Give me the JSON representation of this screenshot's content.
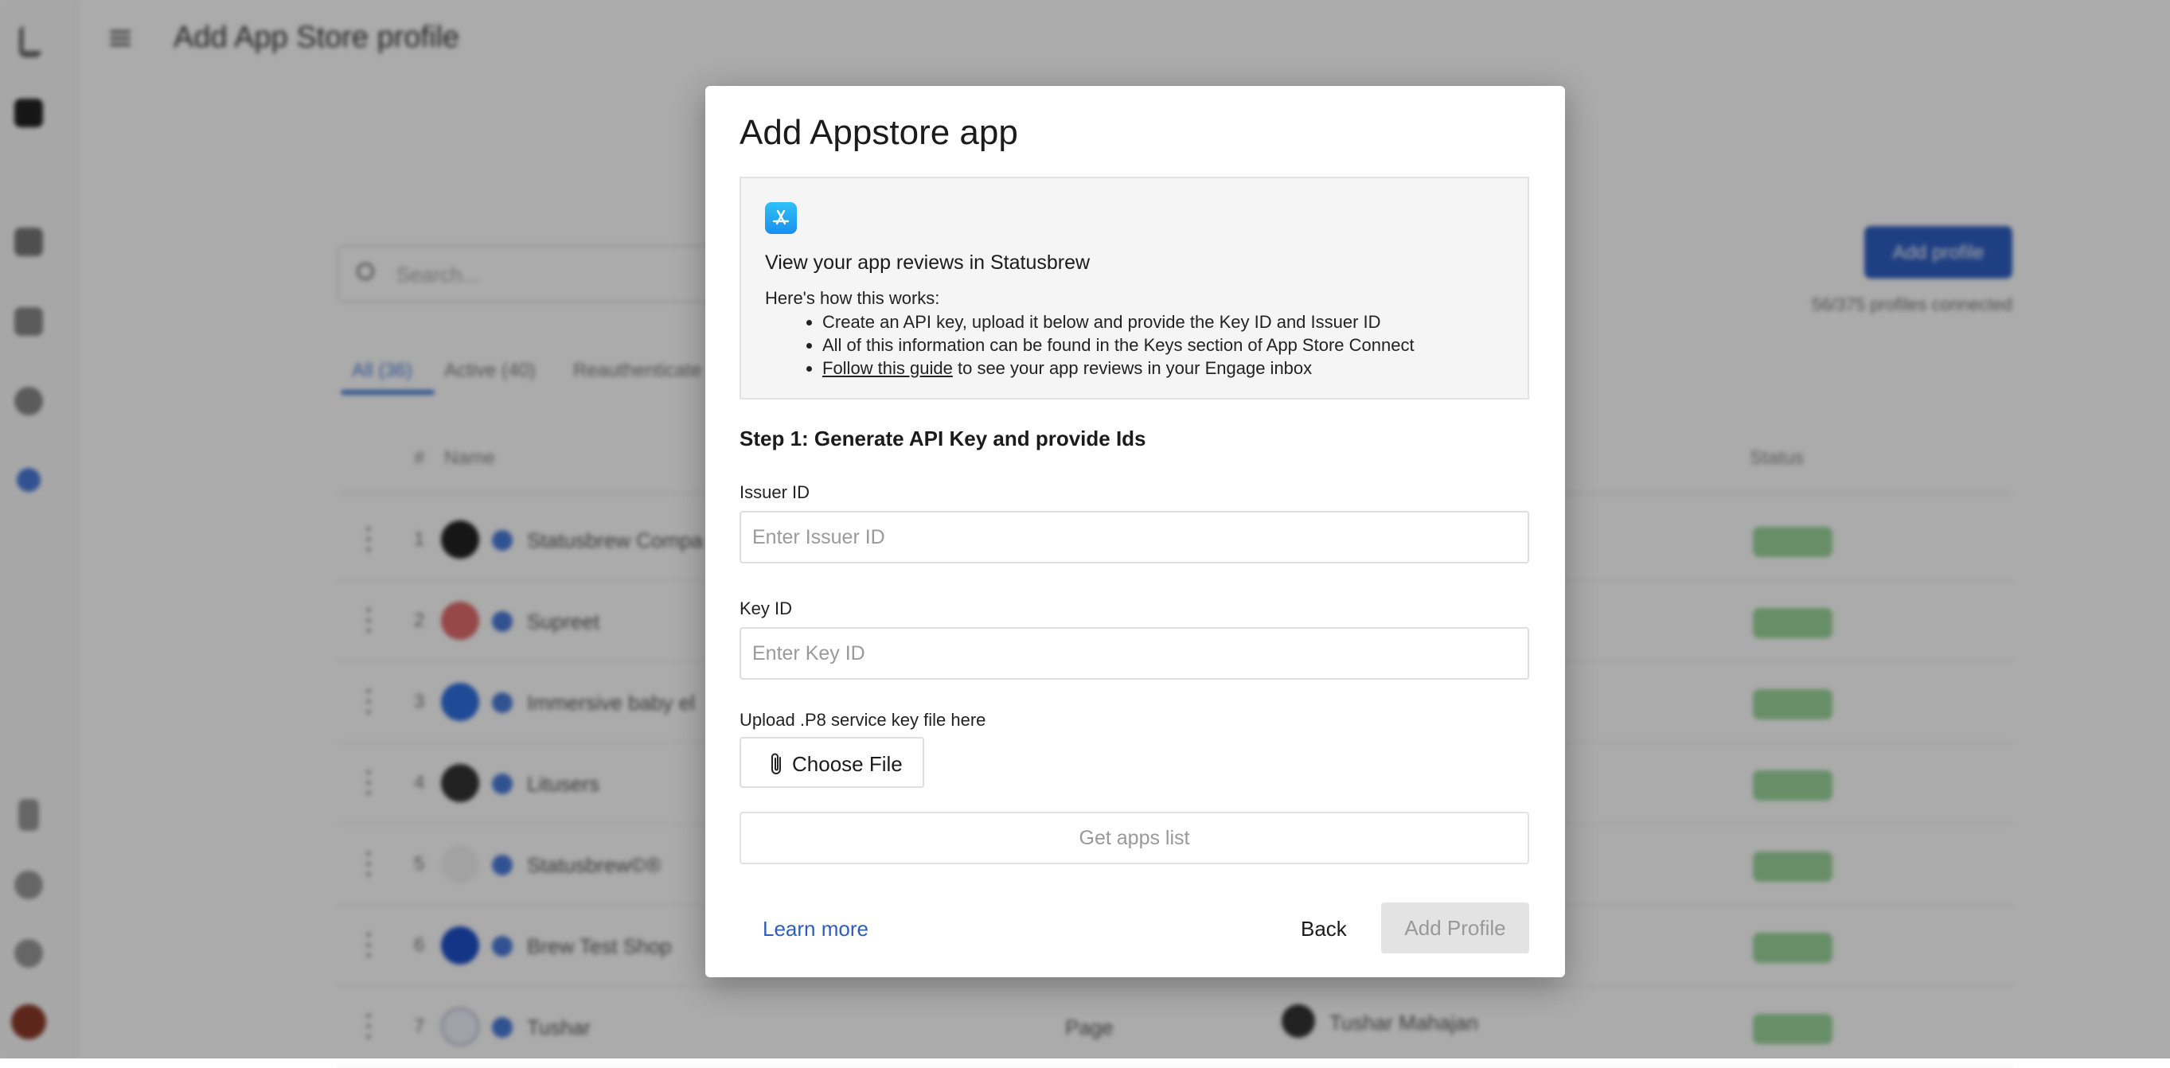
{
  "background": {
    "header_title": "Add App Store profile",
    "search_placeholder": "Search...",
    "tabs": [
      "All (36)",
      "Active (40)",
      "Reauthenticate"
    ],
    "columns": {
      "index": "#",
      "name": "Name",
      "status": "Status"
    },
    "rows": [
      {
        "n": "1",
        "name": "Statusbrew Compa"
      },
      {
        "n": "2",
        "name": "Supreet"
      },
      {
        "n": "3",
        "name": "Immersive baby el"
      },
      {
        "n": "4",
        "name": "Litusers"
      },
      {
        "n": "5",
        "name": "Statusbrew©®"
      },
      {
        "n": "6",
        "name": "Brew Test Shop"
      },
      {
        "n": "7",
        "name": "Tushar"
      }
    ],
    "row7_type": "Page",
    "row7_owner": "Tushar Mahajan",
    "add_profile_btn": "Add profile",
    "profiles_connected": "56/375 profiles connected"
  },
  "modal": {
    "title": "Add Appstore app",
    "info": {
      "icon": "app-store-icon",
      "heading": "View your app reviews in Statusbrew",
      "intro": "Here's how this works:",
      "bullets": [
        "Create an API key, upload it below and provide the Key ID and Issuer ID",
        "All of this information can be found in the Keys section of App Store Connect"
      ],
      "guide_link": "Follow this guide",
      "guide_suffix": " to see your app reviews in your Engage inbox"
    },
    "step_title": "Step 1: Generate API Key and provide Ids",
    "issuer": {
      "label": "Issuer ID",
      "placeholder": "Enter Issuer ID",
      "value": ""
    },
    "key": {
      "label": "Key ID",
      "placeholder": "Enter Key ID",
      "value": ""
    },
    "upload": {
      "label": "Upload .P8 service key file here",
      "button": "Choose File",
      "icon": "paperclip-icon"
    },
    "get_apps": "Get apps list",
    "learn_more": "Learn more",
    "back": "Back",
    "add_profile": "Add Profile"
  },
  "colors": {
    "link": "#2e5fb8",
    "accent": "#2f5fc4",
    "disabled_bg": "#e3e3e3"
  }
}
